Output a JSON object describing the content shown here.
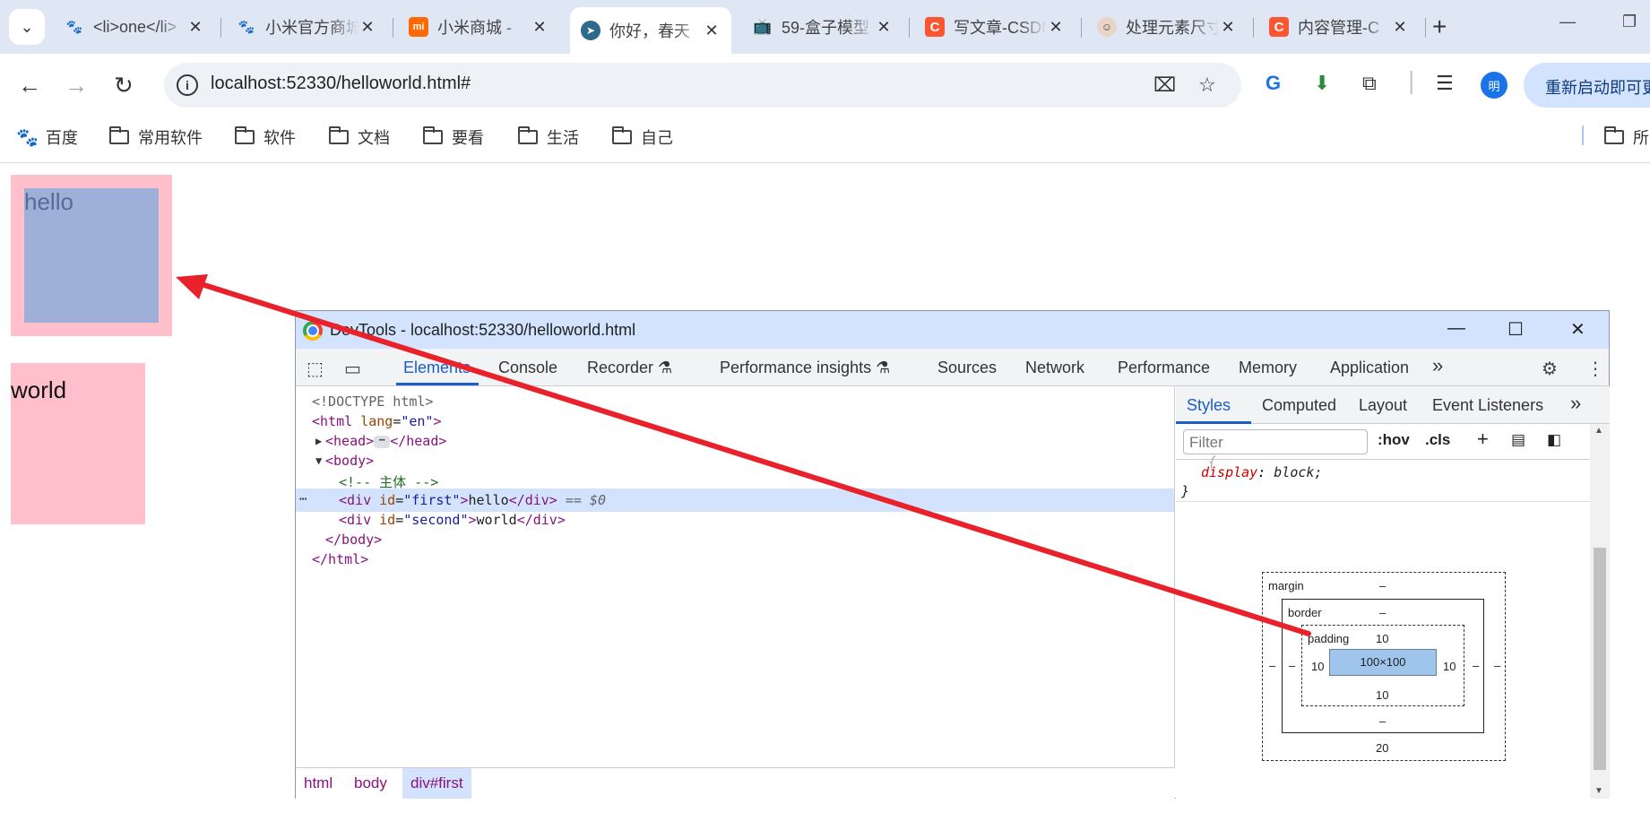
{
  "browser": {
    "tabs": [
      {
        "title": "<li>one</li>",
        "favicon": "baidu-paw-icon",
        "active": false
      },
      {
        "title": "小米官方商城",
        "favicon": "baidu-paw-icon",
        "active": false
      },
      {
        "title": "小米商城 - ",
        "favicon": "mi-logo-icon",
        "active": false
      },
      {
        "title": "你好，春天",
        "favicon": "cursor-logo-icon",
        "active": true
      },
      {
        "title": "59-盒子模型",
        "favicon": "bilibili-tv-icon",
        "active": false
      },
      {
        "title": "写文章-CSDN",
        "favicon": "csdn-c-icon",
        "active": false
      },
      {
        "title": "处理元素尺寸",
        "favicon": "avatar-icon",
        "active": false
      },
      {
        "title": "内容管理-C",
        "favicon": "csdn-c-icon",
        "active": false
      }
    ],
    "address": "localhost:52330/helloworld.html#",
    "relaunch_label": "重新启动即可更",
    "profile_initial": "明",
    "bookmarks": [
      {
        "label": "百度",
        "icon": "baidu-paw-icon"
      },
      {
        "label": "常用软件",
        "icon": "folder-icon"
      },
      {
        "label": "软件",
        "icon": "folder-icon"
      },
      {
        "label": "文档",
        "icon": "folder-icon"
      },
      {
        "label": "要看",
        "icon": "folder-icon"
      },
      {
        "label": "生活",
        "icon": "folder-icon"
      },
      {
        "label": "自己",
        "icon": "folder-icon"
      }
    ],
    "bookmarks_overflow": "所"
  },
  "page": {
    "first_text": "hello",
    "second_text": "world",
    "colors": {
      "box_bg": "#ffc0cb",
      "highlight": "#9fb0d8"
    }
  },
  "devtools": {
    "title": "DevTools - localhost:52330/helloworld.html",
    "tabs": [
      "Elements",
      "Console",
      "Recorder",
      "Performance insights",
      "Sources",
      "Network",
      "Performance",
      "Memory",
      "Application"
    ],
    "active_tab": "Elements",
    "more": "»",
    "dom": {
      "doctype": "<!DOCTYPE html>",
      "html_open_tag": "<html",
      "html_attr": "lang",
      "html_attr_val": "\"en\"",
      "head_open": "<head>",
      "head_close": "</head>",
      "body_open": "<body>",
      "comment": "<!-- 主体 -->",
      "div_open": "<div",
      "id_attr": "id",
      "first_id": "\"first\"",
      "first_text": "hello",
      "div_close": "</div>",
      "selected_marker": "== $0",
      "second_id": "\"second\"",
      "second_text": "world",
      "body_close": "</body>",
      "html_close": "</html>",
      "tag_end": ">",
      "equals": "=",
      "ellipsis": "⋯",
      "row_dots": "⋯"
    },
    "breadcrumbs": [
      "html",
      "body",
      "div#first"
    ],
    "styles": {
      "tabs": [
        "Styles",
        "Computed",
        "Layout",
        "Event Listeners"
      ],
      "more": "»",
      "filter_placeholder": "Filter",
      "hov": ":hov",
      "cls": ".cls",
      "rule_brace_top": "{",
      "rule_prop": "display",
      "rule_val": "block;",
      "rule_brace_close": "}",
      "rule_colon": ":"
    },
    "box_model": {
      "margin_label": "margin",
      "margin_top": "–",
      "margin_bottom": "20",
      "margin_left": "–",
      "margin_right": "–",
      "border_label": "border",
      "border_top": "–",
      "border_bottom": "–",
      "border_left": "–",
      "border_right": "–",
      "padding_label": "padding",
      "padding_top": "10",
      "padding_bottom": "10",
      "padding_left": "10",
      "padding_right": "10",
      "content": "100×100"
    }
  },
  "annotation": {
    "arrow_color": "#e8212a"
  }
}
